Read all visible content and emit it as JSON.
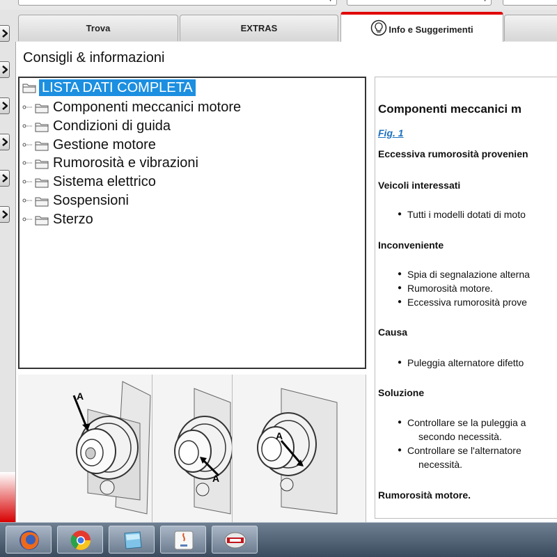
{
  "tabs": [
    {
      "label": "Trova",
      "active": false
    },
    {
      "label": "EXTRAS",
      "active": false
    },
    {
      "label": "Info e Suggerimenti",
      "active": true,
      "icon": "lightbulb-icon"
    },
    {
      "label": "",
      "active": false
    }
  ],
  "panel": {
    "title": "Consigli & informazioni"
  },
  "tree": {
    "root": "LISTA DATI COMPLETA",
    "items": [
      "Componenti meccanici motore",
      "Condizioni di guida",
      "Gestione motore",
      "Rumorosità e vibrazioni",
      "Sistema elettrico",
      "Sospensioni",
      "Sterzo"
    ]
  },
  "figures": {
    "labels": [
      "A",
      "A",
      "A"
    ]
  },
  "info": {
    "heading": "Componenti meccanici m",
    "fig_link": "Fig. 1",
    "title": "Eccessiva rumorosità provenien",
    "veicoli_heading": "Veicoli interessati",
    "veicoli_items": [
      "Tutti i modelli dotati di moto"
    ],
    "inconveniente_heading": "Inconveniente",
    "inconveniente_items": [
      "Spia di segnalazione alterna",
      "Rumorosità motore.",
      "Eccessiva rumorosità prove"
    ],
    "causa_heading": "Causa",
    "causa_items": [
      "Puleggia alternatore difetto"
    ],
    "soluzione_heading": "Soluzione",
    "soluzione_item1": "Controllare se la puleggia a",
    "soluzione_item1_cont": "secondo necessità.",
    "soluzione_item2": "Controllare se l'alternatore",
    "soluzione_item2_cont": "necessità.",
    "next_heading": "Rumorosità motore."
  },
  "taskbar": {
    "apps": [
      "firefox-icon",
      "chrome-icon",
      "window-app-icon",
      "java-icon",
      "wow-app-icon"
    ]
  },
  "colors": {
    "accent_red": "#e00000",
    "selection_blue": "#1c8fe0",
    "link_blue": "#1b70c0"
  }
}
